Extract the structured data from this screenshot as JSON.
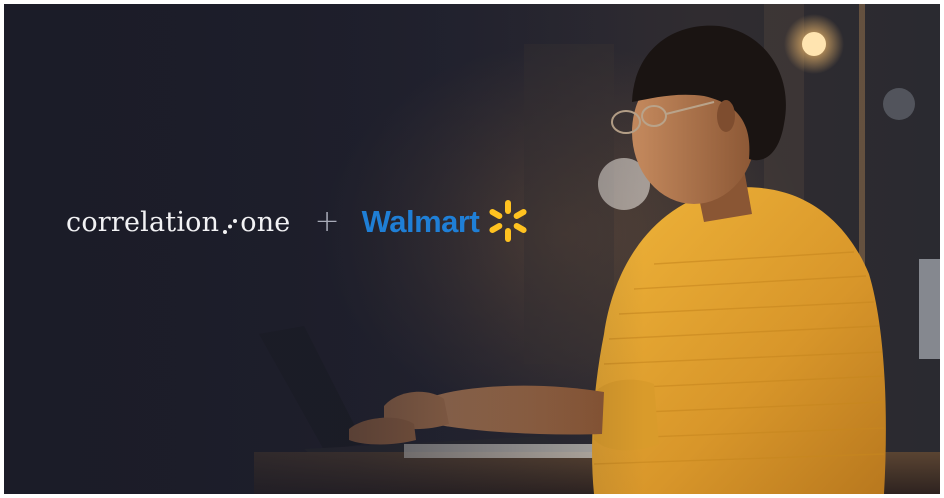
{
  "logos": {
    "partner_text_part1": "correlation",
    "partner_text_part2": "one",
    "plus_symbol": "+",
    "walmart_text": "Walmart"
  },
  "icons": {
    "dots": "correlation-dots-icon",
    "spark": "walmart-spark-icon"
  },
  "colors": {
    "background": "#1d1e2b",
    "walmart_blue": "#1f7fd6",
    "walmart_yellow": "#ffc220",
    "sweater": "#e6a62c"
  }
}
